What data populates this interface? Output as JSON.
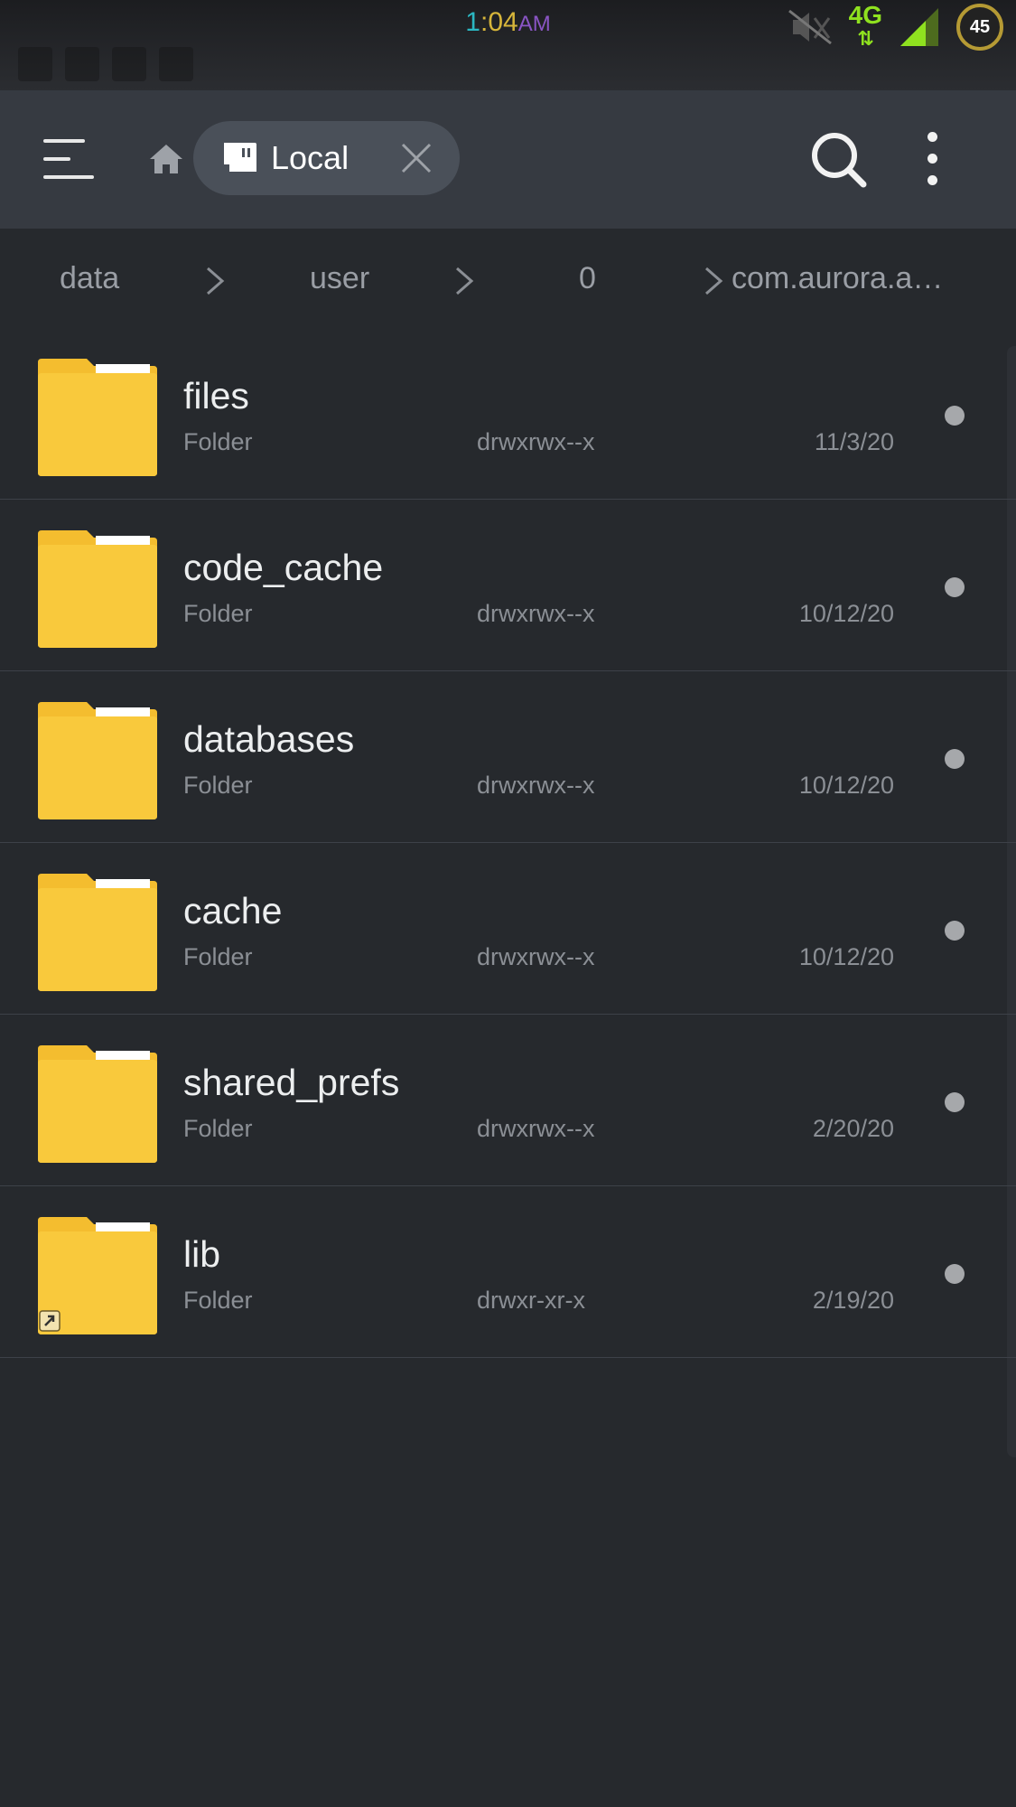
{
  "status_bar": {
    "time_hour": "1",
    "time_rest": ":04",
    "ampm": "AM",
    "network": "4G",
    "network_arrows": "⇅",
    "battery": "45"
  },
  "toolbar": {
    "menu_icon": "hamburger-menu-icon",
    "home_icon": "home-icon",
    "tab_label": "Local",
    "tab_icon": "storage-card-icon",
    "close_icon": "close-icon",
    "search_icon": "search-icon",
    "more_icon": "more-vertical-icon"
  },
  "breadcrumb": [
    "data",
    "user",
    "0",
    "com.aurora.a…"
  ],
  "files": [
    {
      "name": "files",
      "type": "Folder",
      "perm": "drwxrwx--x",
      "date": "11/3/20"
    },
    {
      "name": "code_cache",
      "type": "Folder",
      "perm": "drwxrwx--x",
      "date": "10/12/20"
    },
    {
      "name": "databases",
      "type": "Folder",
      "perm": "drwxrwx--x",
      "date": "10/12/20"
    },
    {
      "name": "cache",
      "type": "Folder",
      "perm": "drwxrwx--x",
      "date": "10/12/20"
    },
    {
      "name": "shared_prefs",
      "type": "Folder",
      "perm": "drwxrwx--x",
      "date": "2/20/20"
    },
    {
      "name": "lib",
      "type": "Folder",
      "perm": "drwxr-xr-x",
      "date": "2/19/20",
      "shortcut": true
    }
  ],
  "colors": {
    "background": "#26292d",
    "toolbar": "#363a41",
    "folder": "#f8c73a",
    "accent_4g": "#8fe11f"
  }
}
